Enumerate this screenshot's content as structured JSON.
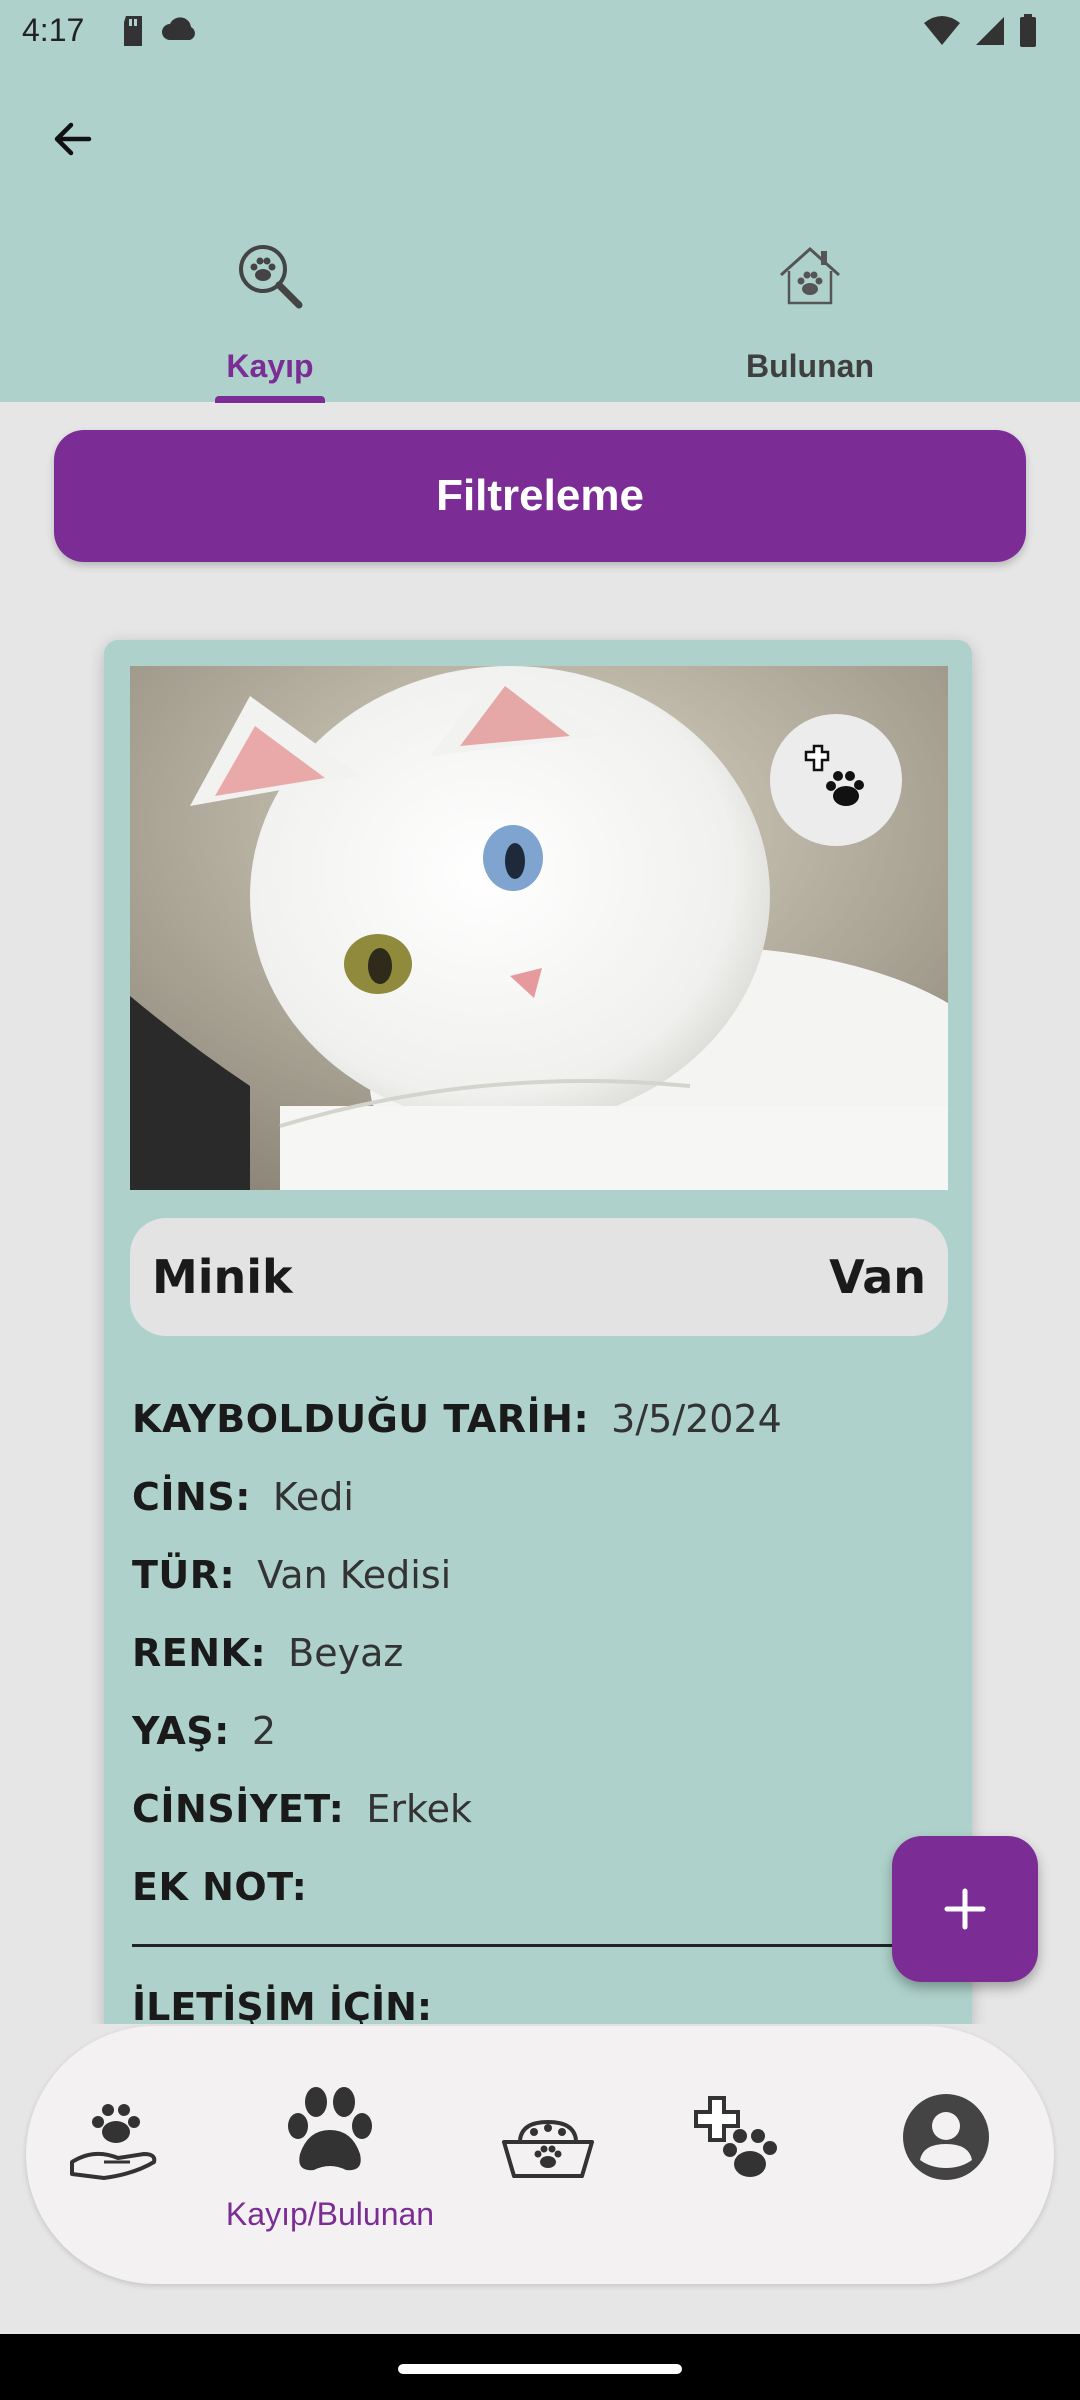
{
  "status_bar": {
    "time": "4:17"
  },
  "header": {
    "tabs": [
      {
        "label": "Kayıp",
        "icon": "paw-search-icon",
        "selected": true
      },
      {
        "label": "Bulunan",
        "icon": "paw-house-icon",
        "selected": false
      }
    ]
  },
  "filter": {
    "label": "Filtreleme"
  },
  "card": {
    "name": "Minik",
    "breed": "Van",
    "fields": [
      {
        "label": "KAYBOLDUĞU TARİH:",
        "value": "3/5/2024"
      },
      {
        "label": "CİNS:",
        "value": "Kedi"
      },
      {
        "label": "TÜR:",
        "value": "Van Kedisi"
      },
      {
        "label": "RENK:",
        "value": "Beyaz"
      },
      {
        "label": "YAŞ:",
        "value": "2"
      },
      {
        "label": "CİNSİYET:",
        "value": "Erkek"
      },
      {
        "label": "EK NOT:",
        "value": ""
      }
    ],
    "contact_label": "İLETİŞİM İÇİN:"
  },
  "bottom_nav": {
    "items": [
      {
        "icon": "paw-hand-icon",
        "label": ""
      },
      {
        "icon": "paw-icon",
        "label": "Kayıp/Bulunan",
        "selected": true
      },
      {
        "icon": "food-bowl-icon",
        "label": ""
      },
      {
        "icon": "vet-paw-icon",
        "label": ""
      },
      {
        "icon": "profile-icon",
        "label": ""
      }
    ]
  },
  "colors": {
    "accent": "#7b2d95",
    "header_bg": "#aed2cb",
    "card_bg": "#aed2cb",
    "page_bg": "#e6e6e6"
  }
}
